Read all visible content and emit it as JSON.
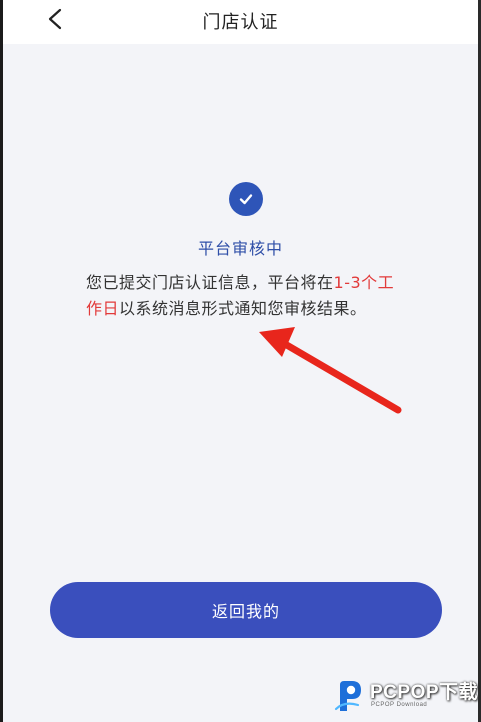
{
  "nav": {
    "title": "门店认证"
  },
  "status": {
    "title": "平台审核中",
    "message_prefix": "您已提交门店认证信息，平台将在",
    "message_highlight": "1-3个工作日",
    "message_suffix": "以系统消息形式通知您审核结果。"
  },
  "actions": {
    "return_label": "返回我的"
  },
  "watermark": {
    "brand": "PCPOP下载",
    "sub": "PCPOP Download"
  },
  "colors": {
    "accent": "#3a4fbd",
    "status_title": "#2f4fa8",
    "highlight": "#e23a3a",
    "background": "#f3f4f8",
    "arrow": "#e8261c"
  },
  "icons": {
    "back": "chevron-left-icon",
    "status": "check-circle-icon",
    "annotation": "red-arrow-icon"
  }
}
